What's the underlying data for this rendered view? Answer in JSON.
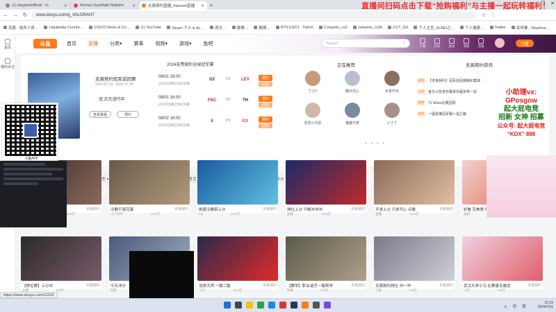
{
  "browser": {
    "tabs": [
      {
        "label": "(1) skypixelofficial · In",
        "active": false
      },
      {
        "label": "Roman DayWalk/ Maksim",
        "active": false
      },
      {
        "label": "无畏契约直播_Valorant直播",
        "active": true
      }
    ],
    "new_tab": "+",
    "window_controls": [
      "—",
      "❐",
      "✕"
    ],
    "url": "www.douyu.com/g_VALORANT",
    "bookmarks": [
      "百度 · 软件人员…",
      "Liquipedia Counte…",
      "CISCO News & Co…",
      "(1) YouTube",
      "Steam 个人 & Ac…",
      "虎牙…",
      "微博…",
      "微博…",
      "RTS ESC3 - Twitch",
      "Compete_cs2",
      "compete_cs2k",
      "CCT_GS",
      "个人主页_SLBEI之…",
      "个人搜索…",
      "Twitter",
      "实时推…Machine…"
    ]
  },
  "overlay_banner": "直播间扫码点击下载“抢购福利”与主播一起玩转福利！",
  "site": {
    "sidebar": [
      {
        "label": "首页"
      },
      {
        "label": "我的关注"
      }
    ],
    "logo": "斗鱼",
    "nav": [
      "首页",
      "直播",
      "分类▾",
      "赛事",
      "视频▾",
      "游戏▾",
      "鱼吧"
    ],
    "nav_active": 1,
    "search_placeholder": "Search",
    "top_icons": [
      "下载",
      "历史",
      "关注",
      "消息",
      "充值"
    ],
    "open_button": "开播",
    "event": {
      "title": "无畏契约冠军巡回赛",
      "subtitle": "2024.07.13 - 2024.07.28",
      "line": "冠  正在进行中",
      "btn1": "查看赛程",
      "btn2": "预约"
    },
    "schedule_title": "2024无畏契约全球冠军赛",
    "matches": [
      {
        "date": "08/01 16:00",
        "sub": "冠军巡回赛全球冠军赛",
        "team_a": "G2",
        "team_b": "LEV",
        "btn": "预约",
        "btn2": "回放"
      },
      {
        "date": "08/01 16:00",
        "sub": "冠军巡回赛全球冠军赛",
        "team_a": "FNC",
        "team_b": "TH",
        "btn": "预约",
        "btn2": "回放"
      },
      {
        "date": "08/02 16:00",
        "sub": "冠军巡回赛全球冠军赛",
        "team_a": "X",
        "team_b": "EG",
        "btn": "预约",
        "btn2": "回放"
      }
    ],
    "streamers_title": "正在推荐",
    "streamers": [
      "丁小T",
      "曙光无心",
      "长发开水",
      "念念小可爱",
      "猫猫不想",
      "小丁丁"
    ],
    "news_title": "无畏契约资讯",
    "news": [
      {
        "tag": "新闻",
        "text": "【无畏契约】冠军巡回赛精彩集锦"
      },
      {
        "tag": "公告",
        "text": "官方公告发布赛事日程安排一览"
      },
      {
        "tag": "赛事",
        "text": "T1 Mobs比赛回顾"
      },
      {
        "tag": "新闻",
        "text": "一图看懂冠军赛八强之路"
      }
    ],
    "filter_chips": [
      "全部",
      "全部类型 ▾",
      "精彩赛事",
      "高端排位",
      "娱乐整活",
      "教学解说",
      "国服高手",
      "技术流派"
    ],
    "filter_active": 0,
    "thumbnails_row1": [
      {
        "title": "华夏午夜场比赛",
        "tag": "无畏契约",
        "streamer": "CSGO官方",
        "count": "26.6万"
      },
      {
        "title": "冷静干就完事",
        "tag": "无畏契约",
        "streamer": "小丁同学",
        "count": "14.3万"
      },
      {
        "title": "刷豪冷静带上分",
        "tag": "无畏契约",
        "streamer": "FQ",
        "count": "23.8万"
      },
      {
        "title": "排位上分 今晚冲冲冲",
        "tag": "无畏契约",
        "streamer": "猛兽",
        "count": "19.6万"
      },
      {
        "title": "不求上分 只求开心 点歌",
        "tag": "无畏契约",
        "streamer": "主播",
        "count": "12.0万"
      },
      {
        "title": "好看 完美男人",
        "tag": "无畏契约",
        "streamer": "美男",
        "count": "9.8万"
      }
    ],
    "thumbnails_row2": [
      {
        "title": "【排位赛】上分中",
        "tag": "无畏契约",
        "streamer": "主播",
        "count": "8.6万"
      },
      {
        "title": "今天冲分",
        "tag": "无畏契约",
        "streamer": "玩家",
        "count": "7.1万"
      },
      {
        "title": "没拼大师 一路二路",
        "tag": "无畏契约",
        "streamer": "小凡",
        "count": "15.4万"
      },
      {
        "title": "【教学】职业选手一路带学",
        "tag": "无畏契约",
        "streamer": "阿峰",
        "count": "6.3万"
      },
      {
        "title": "无畏契约排位 冲一冲",
        "tag": "无畏契约",
        "streamer": "小鱼",
        "count": "5.5万"
      },
      {
        "title": "武汉大学小马 比赛毫无悬念",
        "tag": "无畏契约",
        "streamer": "小马",
        "count": "4.9万"
      }
    ],
    "qr_label": "斗鱼APP",
    "promo": {
      "line1": "小助理vx:",
      "line2": "GPosgow",
      "line3": "起大屁电竞",
      "line4": "招新 女神 招募",
      "line5": "公众号: 起大屁电竞",
      "line6": "“KDX” 888"
    }
  },
  "status_url": "https://www.douyu.com/11222",
  "taskbar": {
    "tray": "∧ 中 英",
    "time": "21:15",
    "date": "2024/7/31"
  }
}
